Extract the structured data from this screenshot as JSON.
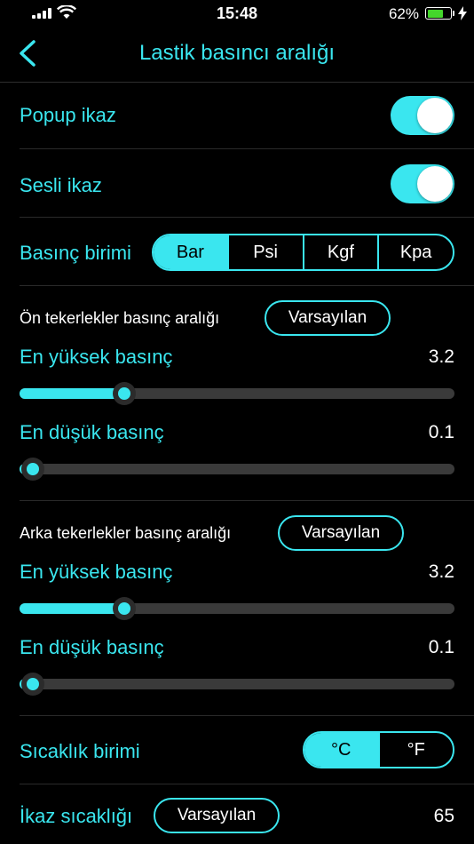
{
  "status": {
    "time": "15:48",
    "battery": "62%"
  },
  "header": {
    "title": "Lastik basıncı aralığı"
  },
  "popup_alert": {
    "label": "Popup ikaz",
    "on": true
  },
  "sound_alert": {
    "label": "Sesli ikaz",
    "on": true
  },
  "pressure_unit": {
    "label": "Basınç birimi",
    "options": [
      "Bar",
      "Psi",
      "Kgf",
      "Kpa"
    ],
    "selected": "Bar"
  },
  "front": {
    "title": "Ön tekerlekler basınç aralığı",
    "default_label": "Varsayılan",
    "high": {
      "label": "En yüksek basınç",
      "value": "3.2",
      "fraction": 0.24
    },
    "low": {
      "label": "En düşük basınç",
      "value": "0.1",
      "fraction": 0.03
    }
  },
  "rear": {
    "title": "Arka tekerlekler basınç aralığı",
    "default_label": "Varsayılan",
    "high": {
      "label": "En yüksek basınç",
      "value": "3.2",
      "fraction": 0.24
    },
    "low": {
      "label": "En düşük basınç",
      "value": "0.1",
      "fraction": 0.03
    }
  },
  "temp_unit": {
    "label": "Sıcaklık birimi",
    "options": [
      "°C",
      "°F"
    ],
    "selected": "°C"
  },
  "alert_temp": {
    "label": "İkaz sıcaklığı",
    "default_label": "Varsayılan",
    "value": "65"
  },
  "colors": {
    "accent": "#3ae6ef",
    "track": "#3a3a3a",
    "background": "#000000",
    "battery": "#44d62c"
  }
}
